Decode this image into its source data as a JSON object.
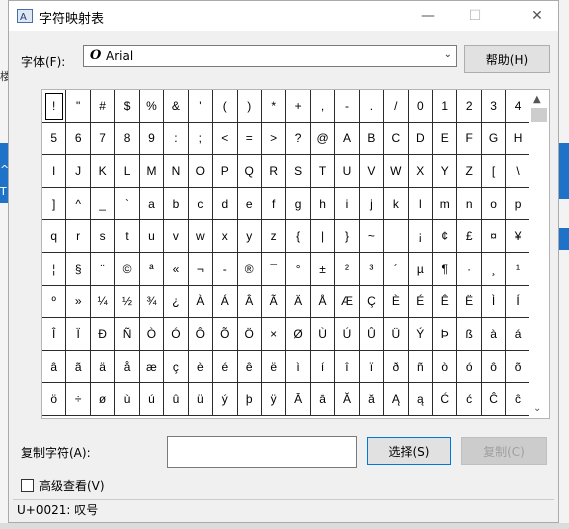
{
  "window": {
    "title": "字符映射表",
    "min_glyph": "—",
    "max_glyph": "☐",
    "close_glyph": "✕"
  },
  "font": {
    "label": "字体(F):",
    "icon_glyph": "O",
    "name": "Arial",
    "dropdown_glyph": "⌄"
  },
  "help_button": "帮助(H)",
  "characters": [
    "!",
    "\"",
    "#",
    "$",
    "%",
    "&",
    "'",
    "(",
    ")",
    "*",
    "+",
    ",",
    "-",
    ".",
    "/",
    "0",
    "1",
    "2",
    "3",
    "4",
    "5",
    "6",
    "7",
    "8",
    "9",
    ":",
    ";",
    "<",
    "=",
    ">",
    "?",
    "@",
    "A",
    "B",
    "C",
    "D",
    "E",
    "F",
    "G",
    "H",
    "I",
    "J",
    "K",
    "L",
    "M",
    "N",
    "O",
    "P",
    "Q",
    "R",
    "S",
    "T",
    "U",
    "V",
    "W",
    "X",
    "Y",
    "Z",
    "[",
    "\\",
    "]",
    "^",
    "_",
    "`",
    "a",
    "b",
    "c",
    "d",
    "e",
    "f",
    "g",
    "h",
    "i",
    "j",
    "k",
    "l",
    "m",
    "n",
    "o",
    "p",
    "q",
    "r",
    "s",
    "t",
    "u",
    "v",
    "w",
    "x",
    "y",
    "z",
    "{",
    "|",
    "}",
    "~",
    " ",
    "¡",
    "¢",
    "£",
    "¤",
    "¥",
    "¦",
    "§",
    "¨",
    "©",
    "ª",
    "«",
    "¬",
    "-",
    "®",
    "¯",
    "°",
    "±",
    "²",
    "³",
    "´",
    "µ",
    "¶",
    "·",
    "¸",
    "¹",
    "º",
    "»",
    "¼",
    "½",
    "¾",
    "¿",
    "À",
    "Á",
    "Â",
    "Ã",
    "Ä",
    "Å",
    "Æ",
    "Ç",
    "È",
    "É",
    "Ê",
    "Ë",
    "Ì",
    "Í",
    "Î",
    "Ï",
    "Ð",
    "Ñ",
    "Ò",
    "Ó",
    "Ô",
    "Õ",
    "Ö",
    "×",
    "Ø",
    "Ù",
    "Ú",
    "Û",
    "Ü",
    "Ý",
    "Þ",
    "ß",
    "à",
    "á",
    "â",
    "ã",
    "ä",
    "å",
    "æ",
    "ç",
    "è",
    "é",
    "ê",
    "ë",
    "ì",
    "í",
    "î",
    "ï",
    "ð",
    "ñ",
    "ò",
    "ó",
    "ô",
    "õ",
    "ö",
    "÷",
    "ø",
    "ù",
    "ú",
    "û",
    "ü",
    "ý",
    "þ",
    "ÿ",
    "Ā",
    "ā",
    "Ă",
    "ă",
    "Ą",
    "ą",
    "Ć",
    "ć",
    "Ĉ",
    "ĉ"
  ],
  "selected_index": 0,
  "scroll": {
    "up": "▲",
    "down": "⌄"
  },
  "copy": {
    "label": "复制字符(A):",
    "value": "",
    "select_button": "选择(S)",
    "copy_button": "复制(C)"
  },
  "advanced": {
    "label": "高级查看(V)",
    "checked": false
  },
  "status": "U+0021: 叹号",
  "background": {
    "left_glyphs": [
      "楼",
      "^",
      "T"
    ]
  },
  "colors": {
    "accent": "#0078d7",
    "side_blue": "#1e73c8"
  }
}
